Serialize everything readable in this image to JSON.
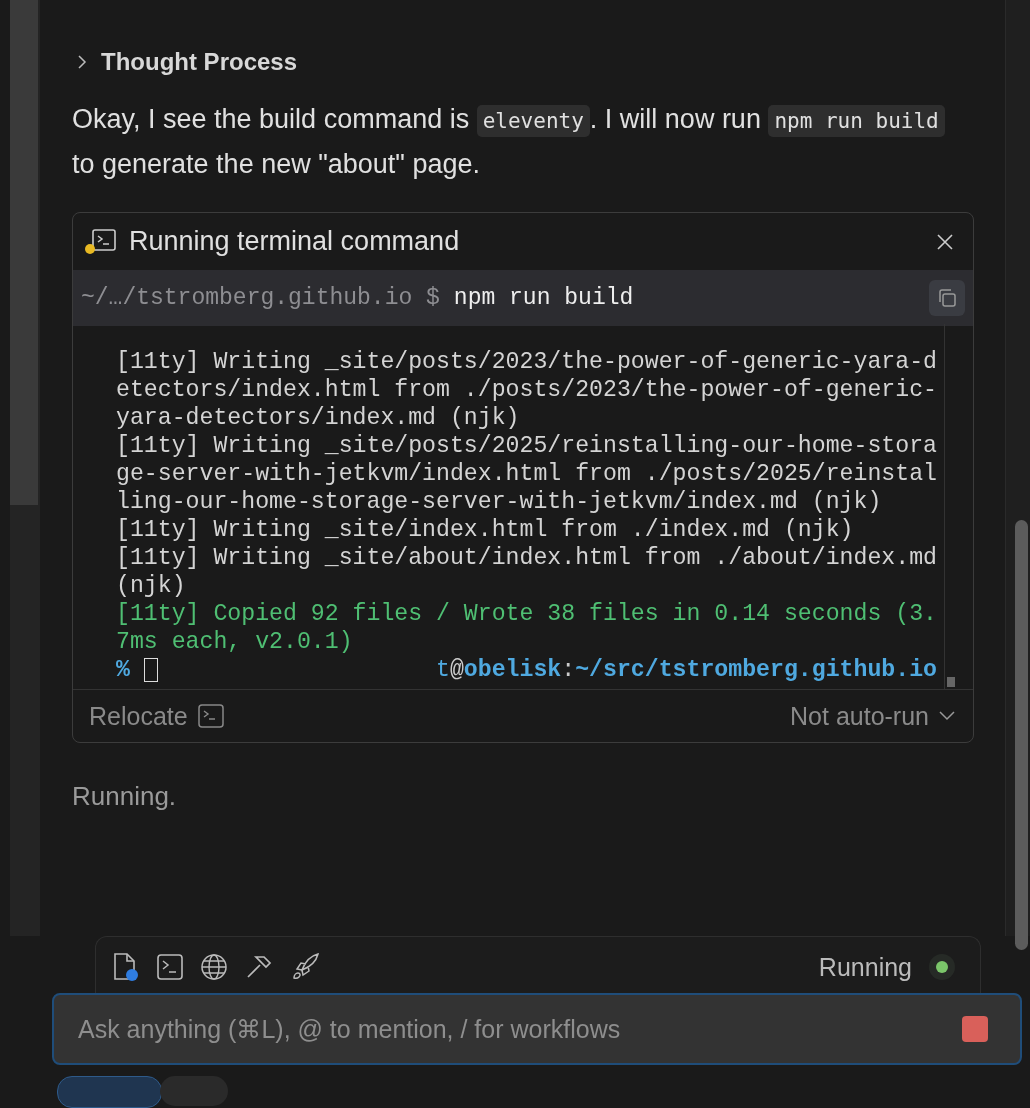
{
  "thought": {
    "label": "Thought Process",
    "expanded": false
  },
  "message": [
    {
      "kind": "text",
      "text": "Okay, I see the build command is "
    },
    {
      "kind": "code",
      "text": "eleventy"
    },
    {
      "kind": "text",
      "text": ". I will now run "
    },
    {
      "kind": "code",
      "text": "npm run build"
    },
    {
      "kind": "text",
      "text": " to generate the new \"about\" page."
    }
  ],
  "terminal": {
    "title": "Running terminal command",
    "cwd": "~/…/tstromberg.github.io $",
    "command": "npm run build",
    "output": [
      {
        "kind": "log",
        "text": "[11ty] Writing _site/posts/2023/the-power-of-generic-yara-detectors/index.html from ./posts/2023/the-power-of-generic-yara-detectors/index.md (njk)"
      },
      {
        "kind": "log",
        "text": "[11ty] Writing _site/posts/2025/reinstalling-our-home-storage-server-with-jetkvm/index.html from ./posts/2025/reinstalling-our-home-storage-server-with-jetkvm/index.md (njk)"
      },
      {
        "kind": "log",
        "text": "[11ty] Writing _site/index.html from ./index.md (njk)"
      },
      {
        "kind": "log",
        "text": "[11ty] Writing _site/about/index.html from ./about/index.md (njk)"
      },
      {
        "kind": "success",
        "text": "[11ty] Copied 92 files / Wrote 38 files in 0.14 seconds (3.7ms each, v2.0.1)"
      }
    ],
    "prompt_symbol": "%",
    "prompt_host": [
      {
        "kind": "user",
        "text": "t"
      },
      {
        "kind": "sep",
        "text": "@"
      },
      {
        "kind": "host",
        "text": "obelisk"
      },
      {
        "kind": "sep",
        "text": ":"
      },
      {
        "kind": "host",
        "text": "~/src/tstromberg.github.io"
      }
    ],
    "relocate_label": "Relocate",
    "run_mode": "Not auto-run"
  },
  "status_text": "Running.",
  "toolbar": {
    "status": "Running"
  },
  "composer": {
    "placeholder": "Ask anything (⌘L), @ to mention, / for workflows"
  }
}
